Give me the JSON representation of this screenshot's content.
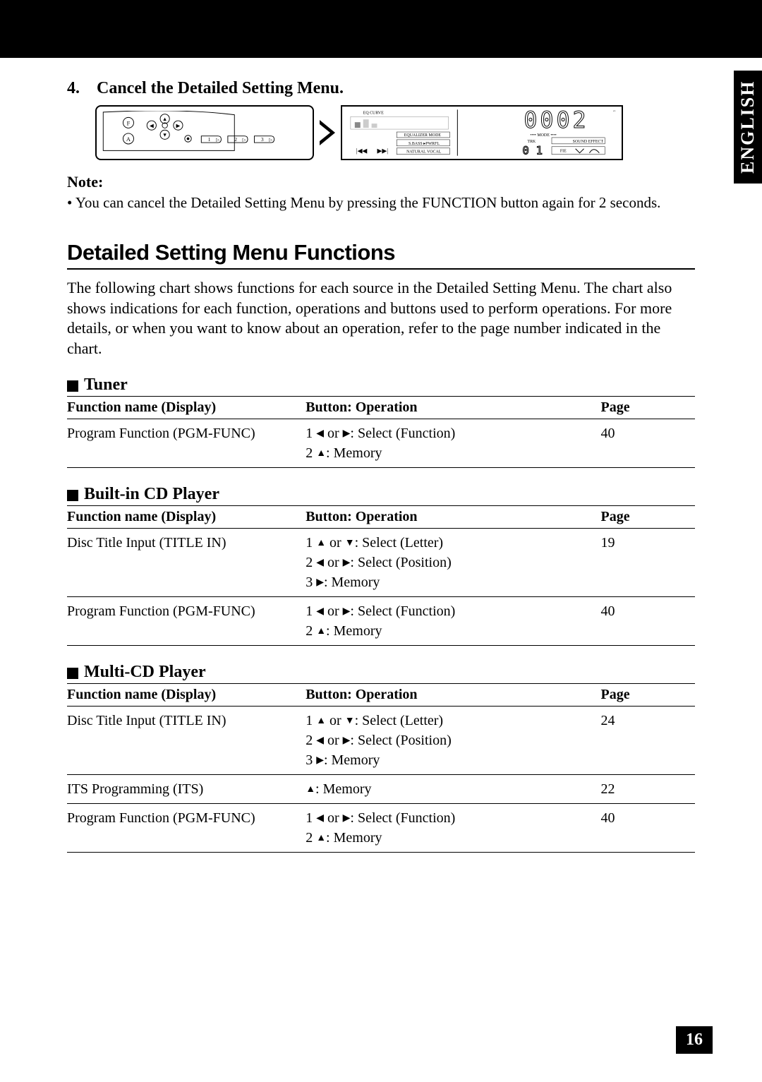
{
  "side_tab": "ENGLISH",
  "page_number": "16",
  "step": {
    "number": "4.",
    "title": "Cancel the Detailed Setting Menu."
  },
  "diagram": {
    "left_labels": {
      "F": "F",
      "A": "A",
      "btn1": "1",
      "btn2": "2",
      "btn3": "3"
    },
    "right_labels": {
      "eq_curve": "EQ CURVE",
      "equalizer_mode": "EQUALIZER MODE",
      "sbass": "S.BASS",
      "pwrfl": "PWRFL",
      "natural_vocal": "NATURAL VOCAL",
      "digits": "0002",
      "mode": "••••  MODE  ••••",
      "trk": "TRK",
      "sound_effect": "SOUND EFFECT",
      "fie": "FIE",
      "trk_num": "01"
    }
  },
  "note": {
    "label": "Note:",
    "body": "• You can cancel the Detailed Setting Menu by pressing the FUNCTION button again for 2 seconds."
  },
  "section_heading": "Detailed Setting Menu Functions",
  "intro": "The following chart shows functions for each source in the Detailed Setting Menu. The chart also shows indications for each function, operations and buttons used to perform operations. For more details, or when you want to know about an operation, refer to the page number indicated in the chart.",
  "headers": {
    "fn": "Function name (Display)",
    "op": "Button: Operation",
    "pg": "Page"
  },
  "sections": [
    {
      "title": "Tuner",
      "rows": [
        {
          "fn": "Program Function (PGM-FUNC)",
          "ops": [
            "1 ◀ or ▶: Select (Function)",
            "2 ▲: Memory"
          ],
          "pg": "40"
        }
      ]
    },
    {
      "title": "Built-in CD Player",
      "rows": [
        {
          "fn": "Disc Title Input (TITLE IN)",
          "ops": [
            "1 ▲ or ▼: Select (Letter)",
            "2 ◀ or ▶: Select (Position)",
            "3 ▶: Memory"
          ],
          "pg": "19"
        },
        {
          "fn": "Program Function (PGM-FUNC)",
          "ops": [
            "1 ◀ or ▶: Select (Function)",
            "2 ▲: Memory"
          ],
          "pg": "40"
        }
      ]
    },
    {
      "title": "Multi-CD Player",
      "rows": [
        {
          "fn": "Disc Title Input (TITLE IN)",
          "ops": [
            "1 ▲ or ▼: Select (Letter)",
            "2 ◀ or ▶: Select (Position)",
            "3 ▶: Memory"
          ],
          "pg": "24"
        },
        {
          "fn": "ITS Programming (ITS)",
          "ops": [
            "▲: Memory"
          ],
          "pg": "22"
        },
        {
          "fn": "Program Function (PGM-FUNC)",
          "ops": [
            "1 ◀ or ▶: Select (Function)",
            "2 ▲: Memory"
          ],
          "pg": "40"
        }
      ]
    }
  ]
}
